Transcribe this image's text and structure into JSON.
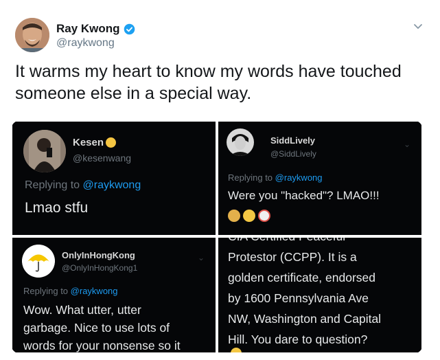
{
  "tweet": {
    "display_name": "Ray Kwong",
    "handle": "@raykwong",
    "text": "It warms my heart to know my words have touched someone else in a special way."
  },
  "screenshots": [
    {
      "name": "Kesen",
      "handle": "@kesenwang",
      "replying_label": "Replying to",
      "replying_to": "@raykwong",
      "body": "Lmao stfu"
    },
    {
      "name": "SiddLively",
      "handle": "@SiddLively",
      "replying_label": "Replying to",
      "replying_to": "@raykwong",
      "body": "Were you \"hacked\"? LMAO!!!"
    },
    {
      "name": "OnlyInHongKong",
      "handle": "@OnlyInHongKong1",
      "replying_label": "Replying to",
      "replying_to": "@raykwong",
      "body_lines": [
        "Wow. What utter, utter",
        "garbage. Nice to use lots of",
        "words for your nonsense so it"
      ]
    },
    {
      "body_lines": [
        "CIA Certified Peaceful",
        "Protestor (CCPP). It is a",
        "golden certificate, endorsed",
        "by 1600 Pennsylvania Ave",
        "NW, Washington and Capital",
        "Hill. You dare to question?"
      ]
    }
  ],
  "colors": {
    "verified_blue": "#1da1f2",
    "mention_blue": "#1d9bf0",
    "panel_bg": "#050608"
  },
  "icons": [
    "verified-badge-icon",
    "chevron-down-icon",
    "umbrella-icon"
  ]
}
